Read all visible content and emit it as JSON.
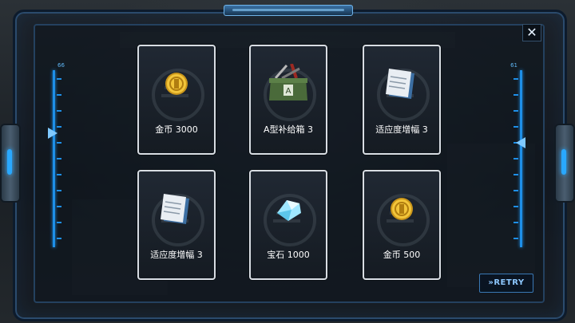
{
  "close_label": "✕",
  "gauges": {
    "left_value": "66",
    "right_value": "61"
  },
  "rewards": [
    {
      "label": "金币 3000",
      "icon": "gold-coin-icon"
    },
    {
      "label": "A型补给箱 3",
      "icon": "supply-crate-icon"
    },
    {
      "label": "适应度增幅 3",
      "icon": "documents-icon"
    },
    {
      "label": "适应度增幅 3",
      "icon": "documents-icon"
    },
    {
      "label": "宝石 1000",
      "icon": "gem-icon"
    },
    {
      "label": "金币 500",
      "icon": "gold-coin-icon"
    }
  ],
  "retry_label": "»RETRY",
  "colors": {
    "accent": "#1e8fe8",
    "card_border": "#d8dde3",
    "coin": "#e8b928"
  }
}
